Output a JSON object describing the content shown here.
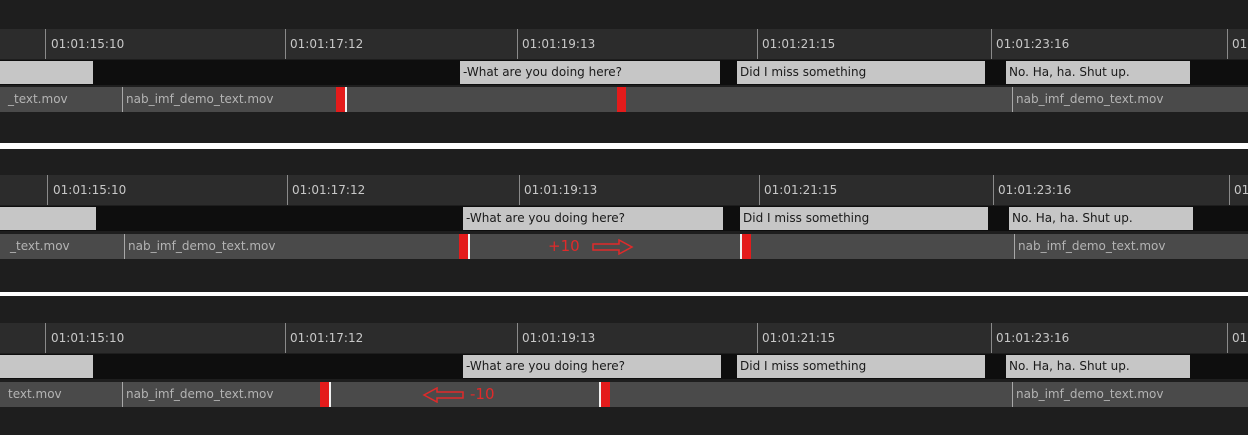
{
  "colors": {
    "marker": "#e41b1b",
    "subtitle_block": "#c6c6c6",
    "panel_bg": "#1e1e1e",
    "track_bg": "#4a4a4a"
  },
  "panels": [
    {
      "timecodes": [
        "01:01:15:10",
        "01:01:17:12",
        "01:01:19:13",
        "01:01:21:15",
        "01:01:23:16",
        "01"
      ],
      "subtitles": [
        "",
        "-What are you doing here?",
        "Did I miss something",
        "No. Ha, ha. Shut up."
      ],
      "clips": [
        "_text.mov",
        "nab_imf_demo_text.mov",
        "nab_imf_demo_text.mov"
      ],
      "offset": {
        "label": "",
        "icon": ""
      }
    },
    {
      "timecodes": [
        "01:01:15:10",
        "01:01:17:12",
        "01:01:19:13",
        "01:01:21:15",
        "01:01:23:16",
        "01"
      ],
      "subtitles": [
        "",
        "-What are you doing here?",
        "Did I miss something",
        "No. Ha, ha. Shut up."
      ],
      "clips": [
        "_text.mov",
        "nab_imf_demo_text.mov",
        "nab_imf_demo_text.mov"
      ],
      "offset": {
        "label": "+10",
        "icon": "arrow-right-icon"
      }
    },
    {
      "timecodes": [
        "01:01:15:10",
        "01:01:17:12",
        "01:01:19:13",
        "01:01:21:15",
        "01:01:23:16",
        "01"
      ],
      "subtitles": [
        "",
        "-What are you doing here?",
        "Did I miss something",
        "No. Ha, ha. Shut up."
      ],
      "clips": [
        "text.mov",
        "nab_imf_demo_text.mov",
        "nab_imf_demo_text.mov"
      ],
      "offset": {
        "label": "-10",
        "icon": "arrow-left-icon"
      }
    }
  ]
}
